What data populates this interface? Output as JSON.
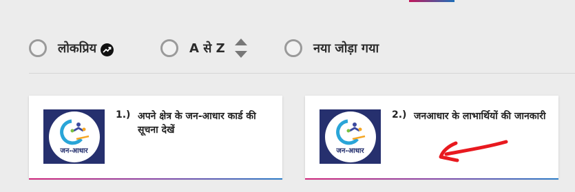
{
  "sort": {
    "options": [
      {
        "label": "लोकप्रिय",
        "icon": "trending-icon"
      },
      {
        "label": "A से Z",
        "icon": "sort-up-down-icon"
      },
      {
        "label": "नया जोड़ा गया"
      }
    ]
  },
  "cards": [
    {
      "number": "1.)",
      "title": "अपने क्षेत्र के जन-आधार कार्ड की सूचना देखें",
      "logo_text": "जन-आधार"
    },
    {
      "number": "2.)",
      "title": "जनआधार के लाभार्थियों की जानकारी",
      "logo_text": "जन-आधार"
    }
  ],
  "colors": {
    "accent_pink": "#d0247a",
    "accent_blue": "#2a7bc6",
    "thumb_bg": "#26306e",
    "annotation_red": "#e8191f"
  }
}
